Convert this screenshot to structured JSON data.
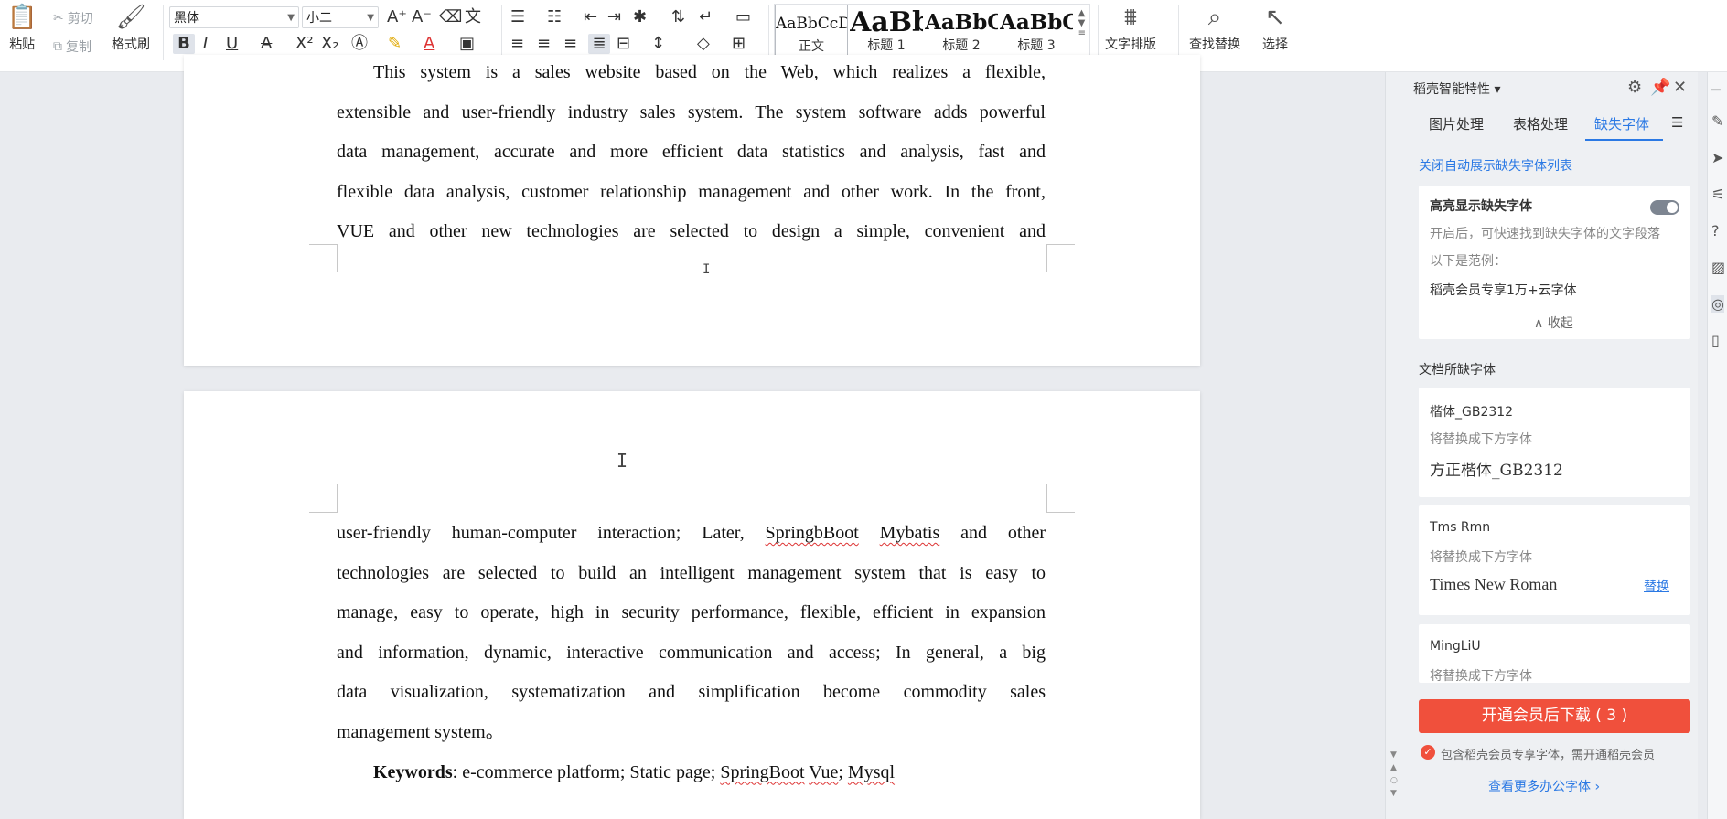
{
  "ribbon": {
    "paste_label": "粘贴",
    "cut_label": "剪切",
    "copy_label": "复制",
    "format_painter_label": "格式刷",
    "font_name": "黑体",
    "font_size": "小二",
    "styles": [
      {
        "preview": "AaBbCcDd",
        "name": "正文"
      },
      {
        "preview": "AaBb",
        "name": "标题 1"
      },
      {
        "preview": "AaBbC",
        "name": "标题 2"
      },
      {
        "preview": "AaBbC",
        "name": "标题 3"
      }
    ],
    "text_layout_label": "文字排版",
    "find_replace_label": "查找替换",
    "select_label": "选择"
  },
  "document": {
    "page1_lines": [
      "This system is a sales website based on the Web, which realizes a flexible,",
      "extensible and user-friendly industry sales system. The system software adds powerful",
      "data management, accurate and more efficient data statistics and analysis, fast and",
      "flexible data analysis, customer relationship management and other work. In the front,",
      "VUE and other new technologies are selected to design a simple, convenient and"
    ],
    "page2_line1": {
      "pre": "user-friendly human-computer interaction; Later, ",
      "w1": "SpringbBoot",
      "mid": " ",
      "w2": "Mybatis",
      "post": " and other"
    },
    "page2_lines": [
      "technologies are selected to build an intelligent management system that is easy to",
      "manage, easy to operate, high in security performance, flexible, efficient in expansion",
      "and information, dynamic, interactive communication and access; In general, a big",
      "data visualization, systematization and simplification become commodity sales",
      "management system。"
    ],
    "keywords": {
      "label": "Keywords",
      "text": ": e-commerce platform; Static page; ",
      "w1": "SpringBoot",
      "space": " ",
      "w2": "Vue",
      "sep": "; ",
      "w3": "Mysql"
    }
  },
  "panel": {
    "title": "稻壳智能特性",
    "tabs": [
      "图片处理",
      "表格处理",
      "缺失字体"
    ],
    "close_auto_link": "关闭自动展示缺失字体列表",
    "highlight": {
      "title": "高亮显示缺失字体",
      "desc": "开启后，可快速找到缺失字体的文字段落",
      "example_label": "以下是范例：",
      "example": "稻壳会员专享1万+云字体",
      "collapse": "收起"
    },
    "missing_label": "文档所缺字体",
    "fonts": [
      {
        "name": "楷体_GB2312",
        "hint": "将替换成下方字体",
        "replacement": "方正楷体_GB2312",
        "action": ""
      },
      {
        "name": "Tms Rmn",
        "hint": "将替换成下方字体",
        "replacement": "Times New Roman",
        "action": "替换"
      },
      {
        "name": "MingLiU",
        "hint": "将替换成下方字体",
        "replacement": "",
        "action": ""
      }
    ],
    "download_button": "开通会员后下载 ( 3 )",
    "notice": "包含稻壳会员专享字体，需开通稻壳会员",
    "more_link": "查看更多办公字体 ›"
  },
  "colors": {
    "accent": "#2b79e4",
    "download": "#f0503c",
    "spell_error": "#d33"
  }
}
